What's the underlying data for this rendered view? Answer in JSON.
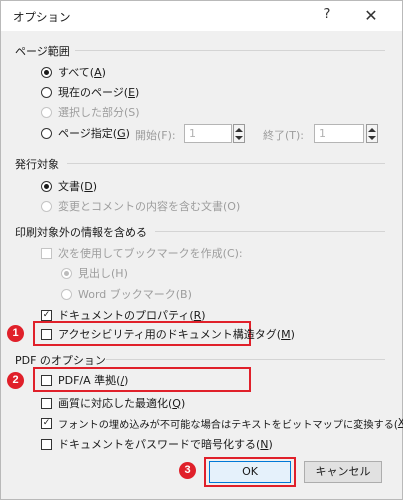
{
  "title": "オプション",
  "help_label": "?",
  "close_label": "✕",
  "page_range": {
    "header": "ページ範囲",
    "all": {
      "text": "すべて(",
      "key": "A",
      "end": ")"
    },
    "current": {
      "text": "現在のページ(",
      "key": "E",
      "end": ")"
    },
    "selection": "選択した部分(S)",
    "pages": {
      "text": "ページ指定(",
      "key": "G",
      "end": ")"
    },
    "start_label": "開始(F):",
    "start_value": "1",
    "end_label": "終了(T):",
    "end_value": "1"
  },
  "publish": {
    "header": "発行対象",
    "document": {
      "text": "文書(",
      "key": "D",
      "end": ")"
    },
    "markup": "変更とコメントの内容を含む文書(O)"
  },
  "non_print": {
    "header": "印刷対象外の情報を含める",
    "bookmarks": "次を使用してブックマークを作成(C):",
    "headings": "見出し(H)",
    "word_bookmarks": "Word ブックマーク(B)",
    "properties": {
      "text": "ドキュメントのプロパティ(",
      "key": "R",
      "end": ")"
    },
    "accessibility": {
      "text": "アクセシビリティ用のドキュメント構造タグ(",
      "key": "M",
      "end": ")"
    }
  },
  "pdf": {
    "header": "PDF のオプション",
    "pdfa": {
      "text": "PDF/A 準拠(",
      "key": "/",
      "end": ")"
    },
    "optimize": {
      "text": "画質に対応した最適化(",
      "key": "Q",
      "end": ")"
    },
    "bitmap": {
      "text": "フォントの埋め込みが不可能な場合はテキストをビットマップに変換する(",
      "key": "X",
      "end": ")"
    },
    "encrypt": {
      "text": "ドキュメントをパスワードで暗号化する(",
      "key": "N",
      "end": ")"
    }
  },
  "buttons": {
    "ok": "OK",
    "cancel": "キャンセル"
  },
  "markers": {
    "one": "1",
    "two": "2",
    "three": "3"
  },
  "checked_mark": "✓",
  "colors": {
    "highlight": "#e0202a",
    "dialog_bg": "#f0f0f0",
    "ok_border": "#0078d7"
  }
}
